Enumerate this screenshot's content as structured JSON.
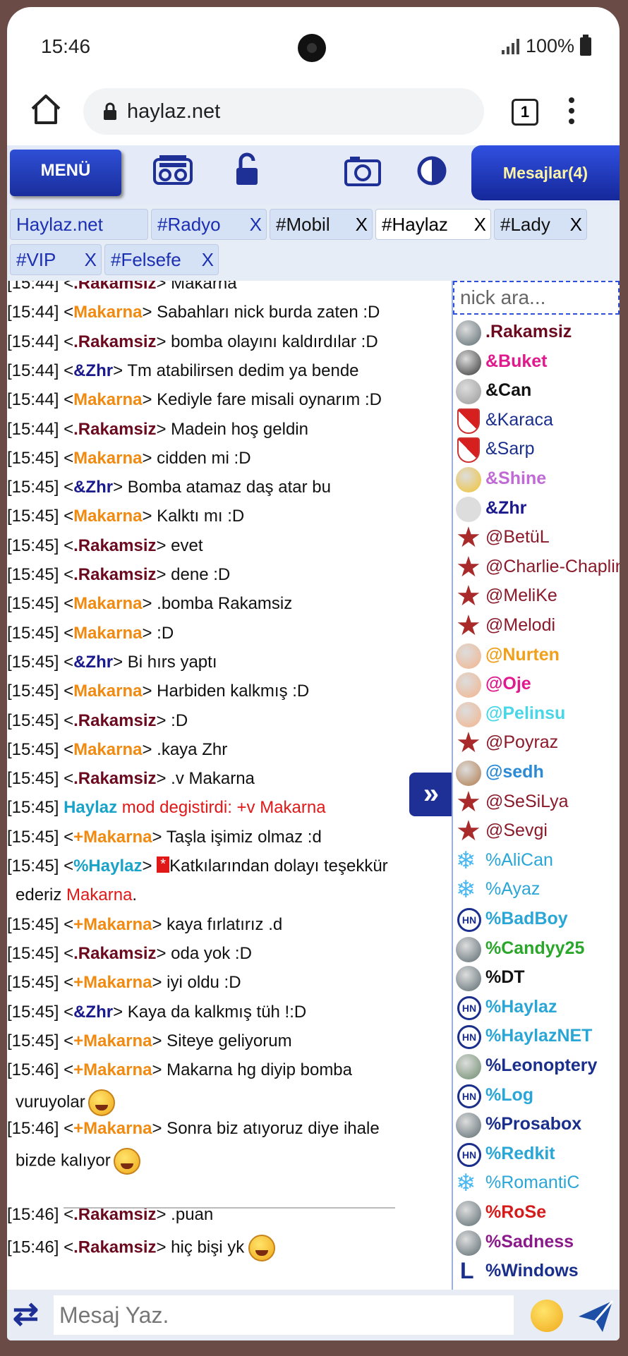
{
  "status": {
    "time": "15:46",
    "battery": "100%"
  },
  "browser": {
    "url": "haylaz.net",
    "tab_count": "1"
  },
  "toolbar": {
    "menu_label": "MENÜ",
    "messages_label": "Mesajlar(4)"
  },
  "tabs": [
    {
      "label": "Haylaz.net",
      "close": ""
    },
    {
      "label": "#Radyo",
      "close": "X"
    },
    {
      "label": "#Mobil",
      "close": "X"
    },
    {
      "label": "#Haylaz",
      "close": "X"
    },
    {
      "label": "#Lady",
      "close": "X"
    },
    {
      "label": "#VIP",
      "close": "X"
    },
    {
      "label": "#Felsefe",
      "close": "X"
    }
  ],
  "messages": [
    {
      "time": "[15:44]",
      "pre": " <",
      "nick": ".Rakamsiz",
      "post": "> Makarna"
    },
    {
      "time": "[15:44]",
      "pre": " <",
      "nick": "Makarna",
      "post": "> Sabahları nick burda zaten :D"
    },
    {
      "time": "[15:44]",
      "pre": " <",
      "nick": ".Rakamsiz",
      "post": "> bomba olayını kaldırdılar :D"
    },
    {
      "time": "[15:44]",
      "pre": " <",
      "nick": "&Zhr",
      "post": "> Tm atabilirsen dedim ya bende"
    },
    {
      "time": "[15:44]",
      "pre": " <",
      "nick": "Makarna",
      "post": "> Kediyle fare misali oynarım :D"
    },
    {
      "time": "[15:44]",
      "pre": " <",
      "nick": ".Rakamsiz",
      "post": "> Madein hoş geldin"
    },
    {
      "time": "[15:45]",
      "pre": " <",
      "nick": "Makarna",
      "post": "> cidden mi :D"
    },
    {
      "time": "[15:45]",
      "pre": " <",
      "nick": "&Zhr",
      "post": "> Bomba atamaz daş atar bu"
    },
    {
      "time": "[15:45]",
      "pre": " <",
      "nick": "Makarna",
      "post": "> Kalktı mı :D"
    },
    {
      "time": "[15:45]",
      "pre": " <",
      "nick": ".Rakamsiz",
      "post": "> evet"
    },
    {
      "time": "[15:45]",
      "pre": " <",
      "nick": ".Rakamsiz",
      "post": "> dene :D"
    },
    {
      "time": "[15:45]",
      "pre": " <",
      "nick": "Makarna",
      "post": "> .bomba Rakamsiz"
    },
    {
      "time": "[15:45]",
      "pre": " <",
      "nick": "Makarna",
      "post": "> :D"
    },
    {
      "time": "[15:45]",
      "pre": " <",
      "nick": "&Zhr",
      "post": "> Bi hırs yaptı"
    },
    {
      "time": "[15:45]",
      "pre": " <",
      "nick": "Makarna",
      "post": "> Harbiden kalkmış :D"
    },
    {
      "time": "[15:45]",
      "pre": " <",
      "nick": ".Rakamsiz",
      "post": "> :D"
    },
    {
      "time": "[15:45]",
      "pre": " <",
      "nick": "Makarna",
      "post": "> .kaya Zhr"
    },
    {
      "time": "[15:45]",
      "pre": " <",
      "nick": ".Rakamsiz",
      "post": "> .v Makarna"
    },
    {
      "time": "[15:45]",
      "pre": " ",
      "nick": "Haylaz",
      "post": " mod degistirdi: +v Makarna"
    },
    {
      "time": "[15:45]",
      "pre": " <",
      "nick": "+Makarna",
      "post": "> Taşla işimiz olmaz :d"
    },
    {
      "time": "[15:45]",
      "pre": " <",
      "nick": "%Haylaz",
      "post": "> ",
      "badge": "*",
      "text": "Katkılarından dolayı teşekkür"
    },
    {
      "cont_a": "ederiz ",
      "cont_b": "Makarna",
      "cont_c": "."
    },
    {
      "time": "[15:45]",
      "pre": " <",
      "nick": "+Makarna",
      "post": "> kaya fırlatırız .d"
    },
    {
      "time": "[15:45]",
      "pre": " <",
      "nick": ".Rakamsiz",
      "post": "> oda yok :D"
    },
    {
      "time": "[15:45]",
      "pre": " <",
      "nick": "+Makarna",
      "post": "> iyi oldu :D"
    },
    {
      "time": "[15:45]",
      "pre": " <",
      "nick": "&Zhr",
      "post": "> Kaya da kalkmış tüh !:D"
    },
    {
      "time": "[15:45]",
      "pre": " <",
      "nick": "+Makarna",
      "post": "> Siteye geliyorum"
    },
    {
      "time": "[15:46]",
      "pre": " <",
      "nick": "+Makarna",
      "post": "> Makarna hg diyip bomba"
    },
    {
      "cont_a": "vuruyolar"
    },
    {
      "time": "[15:46]",
      "pre": " <",
      "nick": "+Makarna",
      "post": "> Sonra biz atıyoruz diye ihale"
    },
    {
      "cont_a": "bizde kalıyor"
    },
    {
      "time": "[15:46]",
      "pre": " <",
      "nick": ".Rakamsiz",
      "post": "> .puan"
    },
    {
      "time": "[15:46]",
      "pre": " <",
      "nick": ".Rakamsiz",
      "post": "> hiç bişi yk"
    }
  ],
  "userlist": {
    "search_placeholder": "nick ara...",
    "users": [
      {
        "nick": ".Rakamsiz",
        "color": "#6b0a1e",
        "bold": true,
        "icon": "avatar"
      },
      {
        "nick": "&Buket",
        "color": "#e0198c",
        "bold": true,
        "icon": "panda-icon"
      },
      {
        "nick": "&Can",
        "color": "#111111",
        "bold": true,
        "icon": "portrait-icon"
      },
      {
        "nick": "&Karaca",
        "color": "#1a2e8c",
        "bold": false,
        "icon": "shield-icon"
      },
      {
        "nick": "&Sarp",
        "color": "#1a2e8c",
        "bold": false,
        "icon": "shield-icon"
      },
      {
        "nick": "&Shine",
        "color": "#c06ad6",
        "bold": true,
        "icon": "crown-icon"
      },
      {
        "nick": "&Zhr",
        "color": "#1a1a8c",
        "bold": true,
        "icon": "dice-icon"
      },
      {
        "nick": "@BetüL",
        "color": "#8a1a2a",
        "bold": false,
        "icon": "star-icon"
      },
      {
        "nick": "@Charlie-Chaplin",
        "color": "#8a1a2a",
        "bold": false,
        "icon": "star-icon"
      },
      {
        "nick": "@MeliKe",
        "color": "#8a1a2a",
        "bold": false,
        "icon": "star-icon"
      },
      {
        "nick": "@Melodi",
        "color": "#8a1a2a",
        "bold": false,
        "icon": "star-icon"
      },
      {
        "nick": "@Nurten",
        "color": "#f0a01a",
        "bold": true,
        "icon": "girl-icon"
      },
      {
        "nick": "@Oje",
        "color": "#e0198c",
        "bold": true,
        "icon": "girl-icon"
      },
      {
        "nick": "@Pelinsu",
        "color": "#49d6e6",
        "bold": true,
        "icon": "girl-icon"
      },
      {
        "nick": "@Poyraz",
        "color": "#8a1a2a",
        "bold": false,
        "icon": "star-icon"
      },
      {
        "nick": "@sedh",
        "color": "#2a8ad6",
        "bold": true,
        "icon": "man-icon"
      },
      {
        "nick": "@SeSiLya",
        "color": "#8a1a2a",
        "bold": false,
        "icon": "star-icon"
      },
      {
        "nick": "@Sevgi",
        "color": "#8a1a2a",
        "bold": false,
        "icon": "star-icon"
      },
      {
        "nick": "%AliCan",
        "color": "#2aa6d6",
        "bold": false,
        "icon": "snowflake-icon"
      },
      {
        "nick": "%Ayaz",
        "color": "#2aa6d6",
        "bold": false,
        "icon": "snowflake-icon"
      },
      {
        "nick": "%BadBoy",
        "color": "#2aa6d6",
        "bold": true,
        "icon": "hn-icon"
      },
      {
        "nick": "%Candyy25",
        "color": "#2aa62a",
        "bold": true,
        "icon": "avatar"
      },
      {
        "nick": "%DT",
        "color": "#111111",
        "bold": true,
        "icon": "avatar"
      },
      {
        "nick": "%Haylaz",
        "color": "#2aa6d6",
        "bold": true,
        "icon": "hn-icon"
      },
      {
        "nick": "%HaylazNET",
        "color": "#2aa6d6",
        "bold": true,
        "icon": "hn-icon"
      },
      {
        "nick": "%Leonoptery",
        "color": "#1a2e8c",
        "bold": true,
        "icon": "mask-icon"
      },
      {
        "nick": "%Log",
        "color": "#2aa6d6",
        "bold": true,
        "icon": "hn-icon"
      },
      {
        "nick": "%Prosabox",
        "color": "#1a2e8c",
        "bold": true,
        "icon": "avatar"
      },
      {
        "nick": "%Redkit",
        "color": "#2aa6d6",
        "bold": true,
        "icon": "hn-icon"
      },
      {
        "nick": "%RomantiC",
        "color": "#2aa6d6",
        "bold": false,
        "icon": "snowflake-icon"
      },
      {
        "nick": "%RoSe",
        "color": "#d61a1a",
        "bold": true,
        "icon": "avatar"
      },
      {
        "nick": "%Sadness",
        "color": "#8a1a8a",
        "bold": true,
        "icon": "avatar"
      },
      {
        "nick": "%Windows",
        "color": "#1a2e8c",
        "bold": true,
        "icon": "l-icon"
      }
    ]
  },
  "composer": {
    "placeholder": "Mesaj Yaz."
  }
}
